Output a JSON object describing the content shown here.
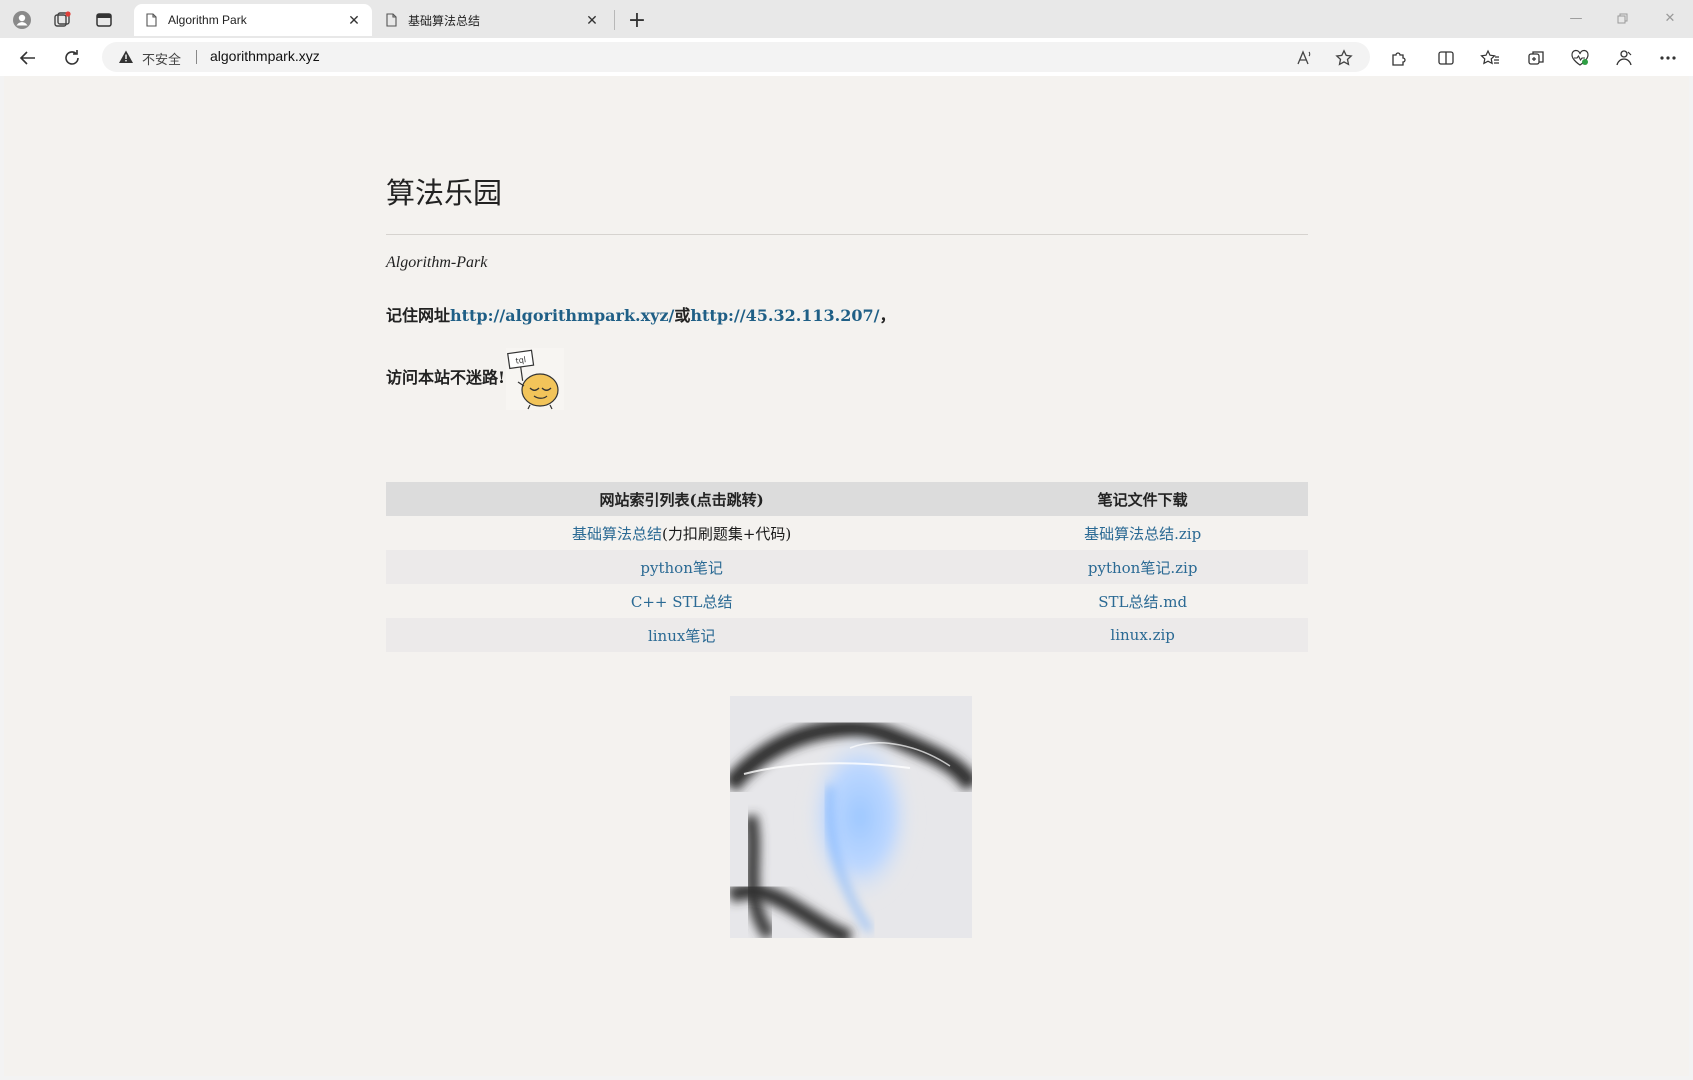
{
  "browser": {
    "tabs": [
      {
        "title": "Algorithm Park",
        "active": true
      },
      {
        "title": "基础算法总结",
        "active": false
      }
    ],
    "address": {
      "security_label": "不安全",
      "url": "algorithmpark.xyz"
    },
    "icons": {
      "profile": "profile-icon",
      "workspaces": "workspaces-icon",
      "tab_actions": "tab-actions-icon",
      "back": "back-arrow-icon",
      "reload": "reload-icon",
      "warning": "warning-triangle-icon",
      "read_aloud": "read-aloud-icon",
      "favorite": "star-icon",
      "extensions": "puzzle-icon",
      "split": "split-screen-icon",
      "favorites": "favorites-icon",
      "collections": "collections-icon",
      "browser_essentials": "heart-pulse-icon",
      "copilot": "copilot-icon",
      "more": "more-icon"
    }
  },
  "page": {
    "title": "算法乐园",
    "subtitle": "Algorithm-Park",
    "remember_prefix": "记住网址",
    "link1": "http://algorithmpark.xyz/",
    "remember_or": "或",
    "link2": "http://45.32.113.207/",
    "remember_suffix": "，",
    "visit_text": "访问本站不迷路!",
    "emoji_sign": "tql",
    "table": {
      "headers": [
        "网站索引列表(点击跳转)",
        "笔记文件下载"
      ],
      "rows": [
        {
          "link": "基础算法总结",
          "extra": "(力扣刷题集+代码)",
          "download": "基础算法总结.zip"
        },
        {
          "link": "python笔记",
          "extra": "",
          "download": "python笔记.zip"
        },
        {
          "link": "C++ STL总结",
          "extra": "",
          "download": "STL总结.md"
        },
        {
          "link": "linux笔记",
          "extra": "",
          "download": "linux.zip"
        }
      ]
    }
  }
}
